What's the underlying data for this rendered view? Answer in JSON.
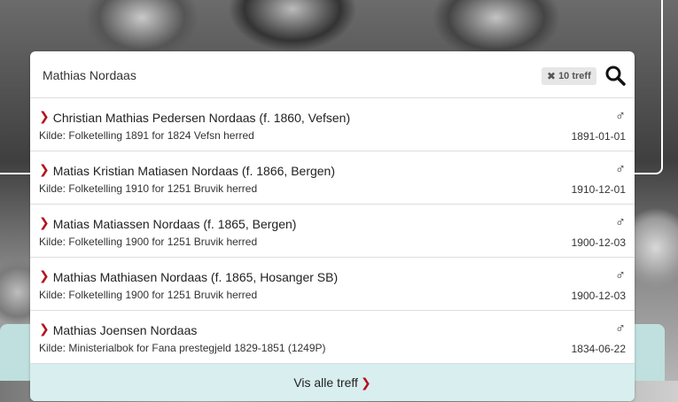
{
  "search": {
    "value": "Mathias Nordaas",
    "hits_label": "10 treff"
  },
  "results": [
    {
      "title": "Christian Mathias Pedersen Nordaas (f. 1860, Vefsen)",
      "source": "Kilde: Folketelling 1891 for 1824 Vefsn herred",
      "gender": "♂",
      "date": "1891-01-01"
    },
    {
      "title": "Matias Kristian Matiasen Nordaas (f. 1866, Bergen)",
      "source": "Kilde: Folketelling 1910 for 1251 Bruvik herred",
      "gender": "♂",
      "date": "1910-12-01"
    },
    {
      "title": "Matias Matiassen Nordaas (f. 1865, Bergen)",
      "source": "Kilde: Folketelling 1900 for 1251 Bruvik herred",
      "gender": "♂",
      "date": "1900-12-03"
    },
    {
      "title": "Mathias Mathiasen Nordaas (f. 1865, Hosanger SB)",
      "source": "Kilde: Folketelling 1900 for 1251 Bruvik herred",
      "gender": "♂",
      "date": "1900-12-03"
    },
    {
      "title": "Mathias Joensen Nordaas",
      "source": "Kilde: Ministerialbok for Fana prestegjeld 1829-1851 (1249P)",
      "gender": "♂",
      "date": "1834-06-22"
    }
  ],
  "footer": {
    "label": "Vis alle treff"
  },
  "icons": {
    "chevron": "chevron-right-icon",
    "search": "search-icon",
    "clear": "close-icon",
    "gender": "male-icon"
  },
  "colors": {
    "accent": "#b3121c",
    "footer_bg": "#d9eeee",
    "teal_panel": "#bfe0df"
  }
}
